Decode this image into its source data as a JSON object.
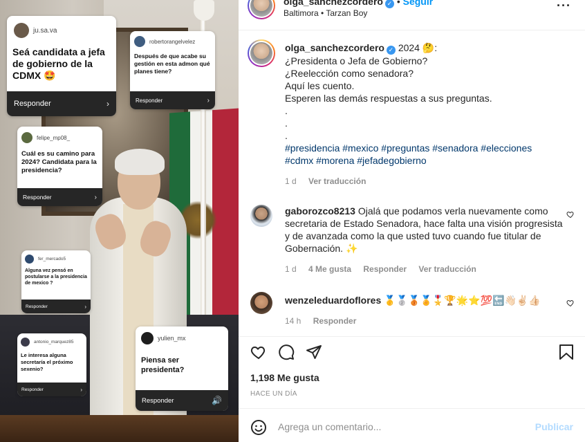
{
  "media": {
    "questions": [
      {
        "user": "ju.sa.va",
        "text": "Seá candidata a jefa de gobierno de la CDMX 🤩",
        "reply": "Responder"
      },
      {
        "user": "robertorangelvelez",
        "text": "Después de que acabe su gestión en esta admon qué planes tiene?",
        "reply": "Responder"
      },
      {
        "user": "felipe_mp08_",
        "text": "Cuál es su camino para 2024? Candidata para la presidencia?",
        "reply": "Responder"
      },
      {
        "user": "fer_mercado5",
        "text": "Alguna vez pensó en postularse a la presidencia de mexico ?",
        "reply": "Responder"
      },
      {
        "user": "antonio_marquez85",
        "text": "Le interesa alguna secretaría el próximo sexenio?",
        "reply": "Responder"
      },
      {
        "user": "yulien_mx",
        "text": "Piensa ser presidenta?",
        "reply": "Responder"
      }
    ],
    "sound_icon": "speaker-icon"
  },
  "header": {
    "username": "olga_sanchezcordero",
    "follow_label": "Seguir",
    "audio": "Baltimora • Tarzan Boy",
    "more_icon": "more-horizontal-icon"
  },
  "caption": {
    "username": "olga_sanchezcordero",
    "first_line": "2024 🤔:",
    "lines": [
      "¿Presidenta o Jefa de Gobierno?",
      "¿Reelección como senadora?",
      "Aquí les cuento.",
      "Esperen las demás respuestas a sus preguntas.",
      ".",
      ".",
      "."
    ],
    "hashtags_1": "#presidencia #mexico #preguntas #senadora #elecciones",
    "hashtags_2": "#cdmx #morena #jefadegobierno",
    "time": "1 d",
    "translate": "Ver traducción"
  },
  "comments": [
    {
      "username": "gaborozco8213",
      "text": "Ojalá que podamos verla nuevamente como secretaria de Estado Senadora, hace falta una visión progresista y de avanzada como la que usted tuvo cuando fue titular de Gobernación. ✨",
      "time": "1 d",
      "likes": "4 Me gusta",
      "reply": "Responder",
      "translate": "Ver traducción"
    },
    {
      "username": "wenzeleduardoflores",
      "text": "🥇🥈🥉🏅🎖️🏆🌟⭐💯🔚👋🏻✌🏻👍🏻",
      "time": "14 h",
      "reply": "Responder"
    }
  ],
  "actions": {
    "like_icon": "heart-icon",
    "comment_icon": "comment-icon",
    "share_icon": "send-icon",
    "save_icon": "bookmark-icon"
  },
  "likes_count": "1,198 Me gusta",
  "posted": "HACE UN DÍA",
  "add_comment": {
    "placeholder": "Agrega un comentario...",
    "publish_label": "Publicar",
    "emoji_icon": "smiley-icon"
  }
}
